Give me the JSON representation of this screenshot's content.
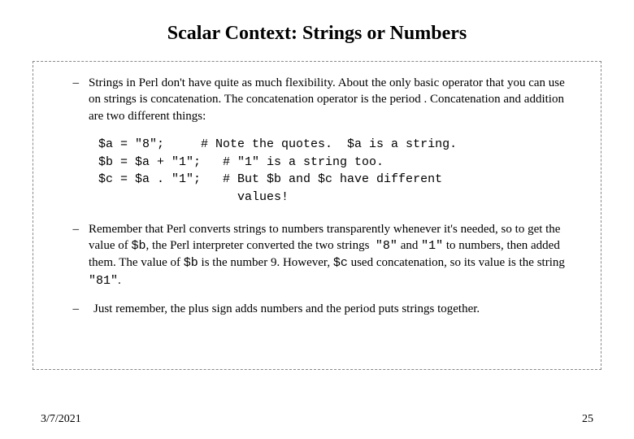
{
  "title": "Scalar Context: Strings or Numbers",
  "bullets": {
    "b1": "Strings in Perl don't have quite as much flexibility. About the only basic operator that you can use on strings is concatenation. The concatenation operator is the period . Concatenation and addition are two different things:",
    "b2_pre": "Remember that Perl converts strings to numbers transparently whenever it's needed, so to get the value of ",
    "b2_var1": "$b",
    "b2_mid1": ", the Perl interpreter converted the two strings ",
    "b2_eight": "\"8\"",
    "b2_and": " and ",
    "b2_one": "\"1\"",
    "b2_mid2": " to numbers, then added them. The value of ",
    "b2_var2": "$b",
    "b2_mid3": " is the number 9. However, ",
    "b2_var3": "$c",
    "b2_mid4": " used concatenation, so its value is the string ",
    "b2_eightyone": "\"81\"",
    "b2_end": ".",
    "b3": "Just remember, the plus sign adds numbers and the period puts strings together."
  },
  "code": "$a = \"8\";     # Note the quotes.  $a is a string.\n$b = $a + \"1\";   # \"1\" is a string too.\n$c = $a . \"1\";   # But $b and $c have different\n                   values!",
  "footer": {
    "date": "3/7/2021",
    "page": "25"
  }
}
